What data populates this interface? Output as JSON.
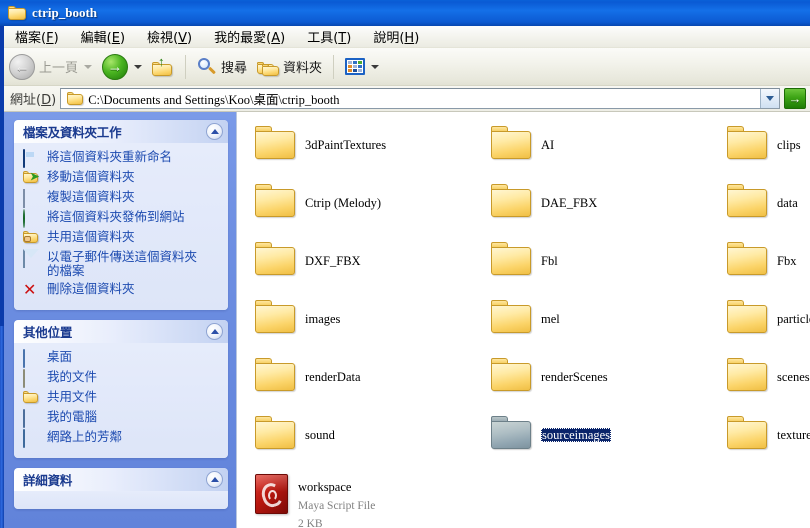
{
  "window": {
    "title": "ctrip_booth",
    "title_icon": "folder-icon"
  },
  "menu": [
    {
      "label": "檔案",
      "mnemonic": "F"
    },
    {
      "label": "編輯",
      "mnemonic": "E"
    },
    {
      "label": "檢視",
      "mnemonic": "V"
    },
    {
      "label": "我的最愛",
      "mnemonic": "A"
    },
    {
      "label": "工具",
      "mnemonic": "T"
    },
    {
      "label": "說明",
      "mnemonic": "H"
    }
  ],
  "toolbar": {
    "back_label": "上一頁",
    "back_icon": "back-arrow-icon",
    "forward_icon": "forward-arrow-icon",
    "up_icon": "up-folder-icon",
    "search_label": "搜尋",
    "search_icon": "magnifier-icon",
    "folders_label": "資料夾",
    "folders_icon": "folders-icon",
    "views_icon": "views-grid-icon"
  },
  "address": {
    "label": "網址",
    "mnemonic": "D",
    "path": "C:\\Documents and Settings\\Koo\\桌面\\ctrip_booth",
    "folder_icon": "folder-icon",
    "dropdown_icon": "chevron-down-icon",
    "go_label": "→",
    "go_icon": "go-arrow-icon"
  },
  "sidebar": {
    "panels": [
      {
        "title": "檔案及資料夾工作",
        "collapse_icon": "chevron-up-icon",
        "items": [
          {
            "label": "將這個資料夾重新命名",
            "icon": "rename-icon"
          },
          {
            "label": "移動這個資料夾",
            "icon": "move-folder-icon"
          },
          {
            "label": "複製這個資料夾",
            "icon": "copy-icon"
          },
          {
            "label": "將這個資料夾發佈到網站",
            "icon": "publish-web-icon"
          },
          {
            "label": "共用這個資料夾",
            "icon": "share-folder-icon"
          },
          {
            "label": "以電子郵件傳送這個資料夾\n的檔案",
            "icon": "email-icon"
          },
          {
            "label": "刪除這個資料夾",
            "icon": "delete-x-icon"
          }
        ]
      },
      {
        "title": "其他位置",
        "collapse_icon": "chevron-up-icon",
        "items": [
          {
            "label": "桌面",
            "icon": "desktop-icon"
          },
          {
            "label": "我的文件",
            "icon": "my-documents-icon"
          },
          {
            "label": "共用文件",
            "icon": "shared-documents-icon"
          },
          {
            "label": "我的電腦",
            "icon": "my-computer-icon"
          },
          {
            "label": "網路上的芳鄰",
            "icon": "network-places-icon"
          }
        ]
      },
      {
        "title": "詳細資料",
        "collapse_icon": "chevron-up-icon",
        "items": []
      }
    ]
  },
  "files": {
    "rows": [
      [
        {
          "name": "3dPaintTextures",
          "type": "folder",
          "selected": false
        },
        {
          "name": "AI",
          "type": "folder",
          "selected": false
        },
        {
          "name": "clips",
          "type": "folder",
          "selected": false
        }
      ],
      [
        {
          "name": "Ctrip (Melody)",
          "type": "folder",
          "selected": false
        },
        {
          "name": "DAE_FBX",
          "type": "folder",
          "selected": false
        },
        {
          "name": "data",
          "type": "folder",
          "selected": false
        }
      ],
      [
        {
          "name": "DXF_FBX",
          "type": "folder",
          "selected": false
        },
        {
          "name": "Fbl",
          "type": "folder",
          "selected": false
        },
        {
          "name": "Fbx",
          "type": "folder",
          "selected": false
        }
      ],
      [
        {
          "name": "images",
          "type": "folder",
          "selected": false
        },
        {
          "name": "mel",
          "type": "folder",
          "selected": false
        },
        {
          "name": "particles",
          "type": "folder",
          "selected": false
        }
      ],
      [
        {
          "name": "renderData",
          "type": "folder",
          "selected": false
        },
        {
          "name": "renderScenes",
          "type": "folder",
          "selected": false
        },
        {
          "name": "scenes",
          "type": "folder",
          "selected": false
        }
      ],
      [
        {
          "name": "sound",
          "type": "folder",
          "selected": false
        },
        {
          "name": "sourceimages",
          "type": "folder",
          "selected": true
        },
        {
          "name": "textures",
          "type": "folder",
          "selected": false
        }
      ],
      [
        {
          "name": "workspace",
          "type": "file",
          "filetype": "Maya Script File",
          "size": "2 KB",
          "selected": false
        }
      ]
    ]
  },
  "colors": {
    "titlebar": "#0a5ad4",
    "sidebar": "#6e8fe2",
    "selection": "#0a246a",
    "link": "#1d4bb0",
    "panel_title": "#1a3a8f"
  }
}
